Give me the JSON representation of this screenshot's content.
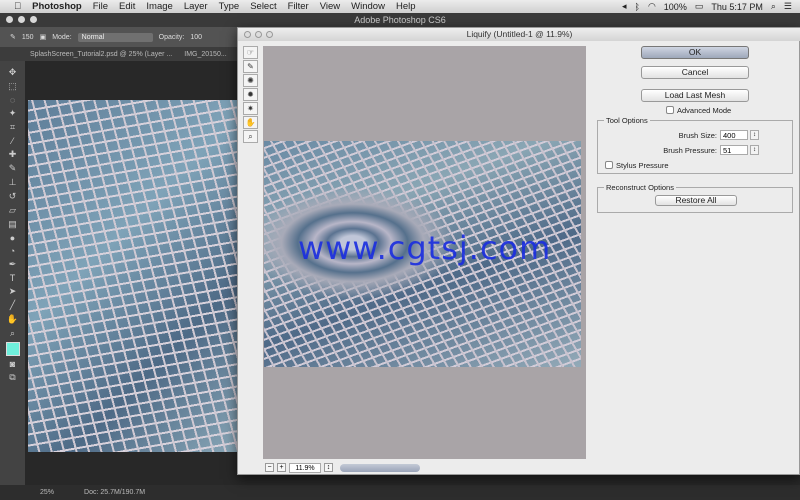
{
  "menubar": {
    "apple": "",
    "app": "Photoshop",
    "items": [
      "File",
      "Edit",
      "Image",
      "Layer",
      "Type",
      "Select",
      "Filter",
      "View",
      "Window",
      "Help"
    ],
    "battery": "100%",
    "clock": "Thu 5:17 PM"
  },
  "ps_window": {
    "title": "Adobe Photoshop CS6"
  },
  "options_bar": {
    "brush_size": "150",
    "mode_label": "Mode:",
    "mode_value": "Normal",
    "opacity_label": "Opacity:",
    "opacity_value": "100"
  },
  "tabs": [
    "SplashScreen_Tutorial2.psd @ 25% (Layer ...",
    "IMG_20150..."
  ],
  "status": {
    "zoom": "25%",
    "doc": "Doc: 25.7M/190.7M"
  },
  "dialog": {
    "title": "Liquify (Untitled-1 @ 11.9%)",
    "zoom": "11.9%",
    "ok": "OK",
    "cancel": "Cancel",
    "load_mesh": "Load Last Mesh",
    "advanced_mode": "Advanced Mode",
    "tool_options": {
      "legend": "Tool Options",
      "brush_size_label": "Brush Size:",
      "brush_size": "400",
      "brush_pressure_label": "Brush Pressure:",
      "brush_pressure": "51",
      "stylus_pressure": "Stylus Pressure"
    },
    "reconstruct": {
      "legend": "Reconstruct Options",
      "restore_all": "Restore All"
    },
    "tools": [
      "forward-warp",
      "reconstruct",
      "twirl",
      "pucker",
      "bloat",
      "hand",
      "zoom"
    ]
  },
  "watermark": "www.cgtsj.com"
}
